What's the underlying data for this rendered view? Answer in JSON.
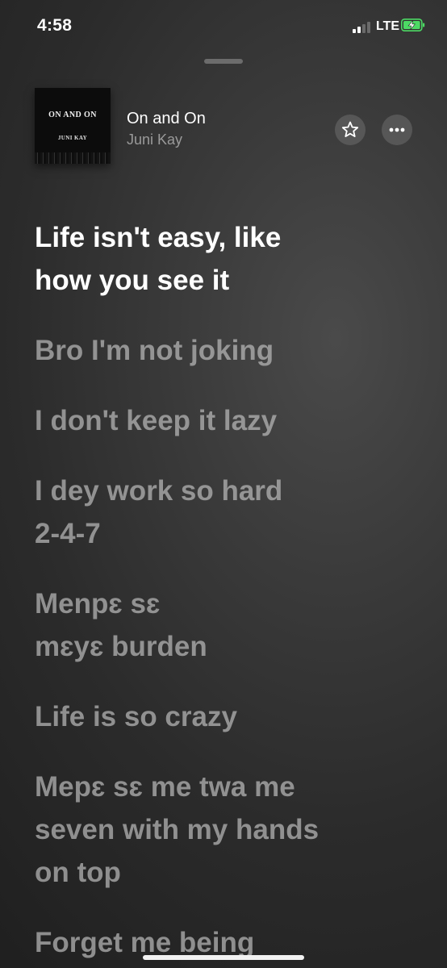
{
  "status_bar": {
    "time": "4:58",
    "network": "LTE",
    "icons": [
      "signal-icon",
      "battery-charging-icon"
    ]
  },
  "now_playing": {
    "artwork": {
      "title_text": "ON AND ON",
      "artist_text": "JUNI KAY"
    },
    "title": "On and On",
    "artist": "Juni Kay",
    "favorite_icon": "star-icon",
    "more_icon": "ellipsis-icon"
  },
  "lyrics": [
    "Life isn't easy, like\nhow you see it",
    "Bro I'm not joking",
    "I don't keep it lazy",
    "I dey work so hard\n2-4-7",
    "Menpɛ sɛ\nmɛyɛ burden",
    "Life is so crazy",
    "Mepɛ sɛ me twa me\nseven with my hands\non top",
    "Forget me being"
  ],
  "active_lyric_index": 0,
  "colors": {
    "accent_battery": "#4cd964",
    "active_lyric": "#ffffff",
    "inactive_lyric": "#b9b9b9"
  }
}
